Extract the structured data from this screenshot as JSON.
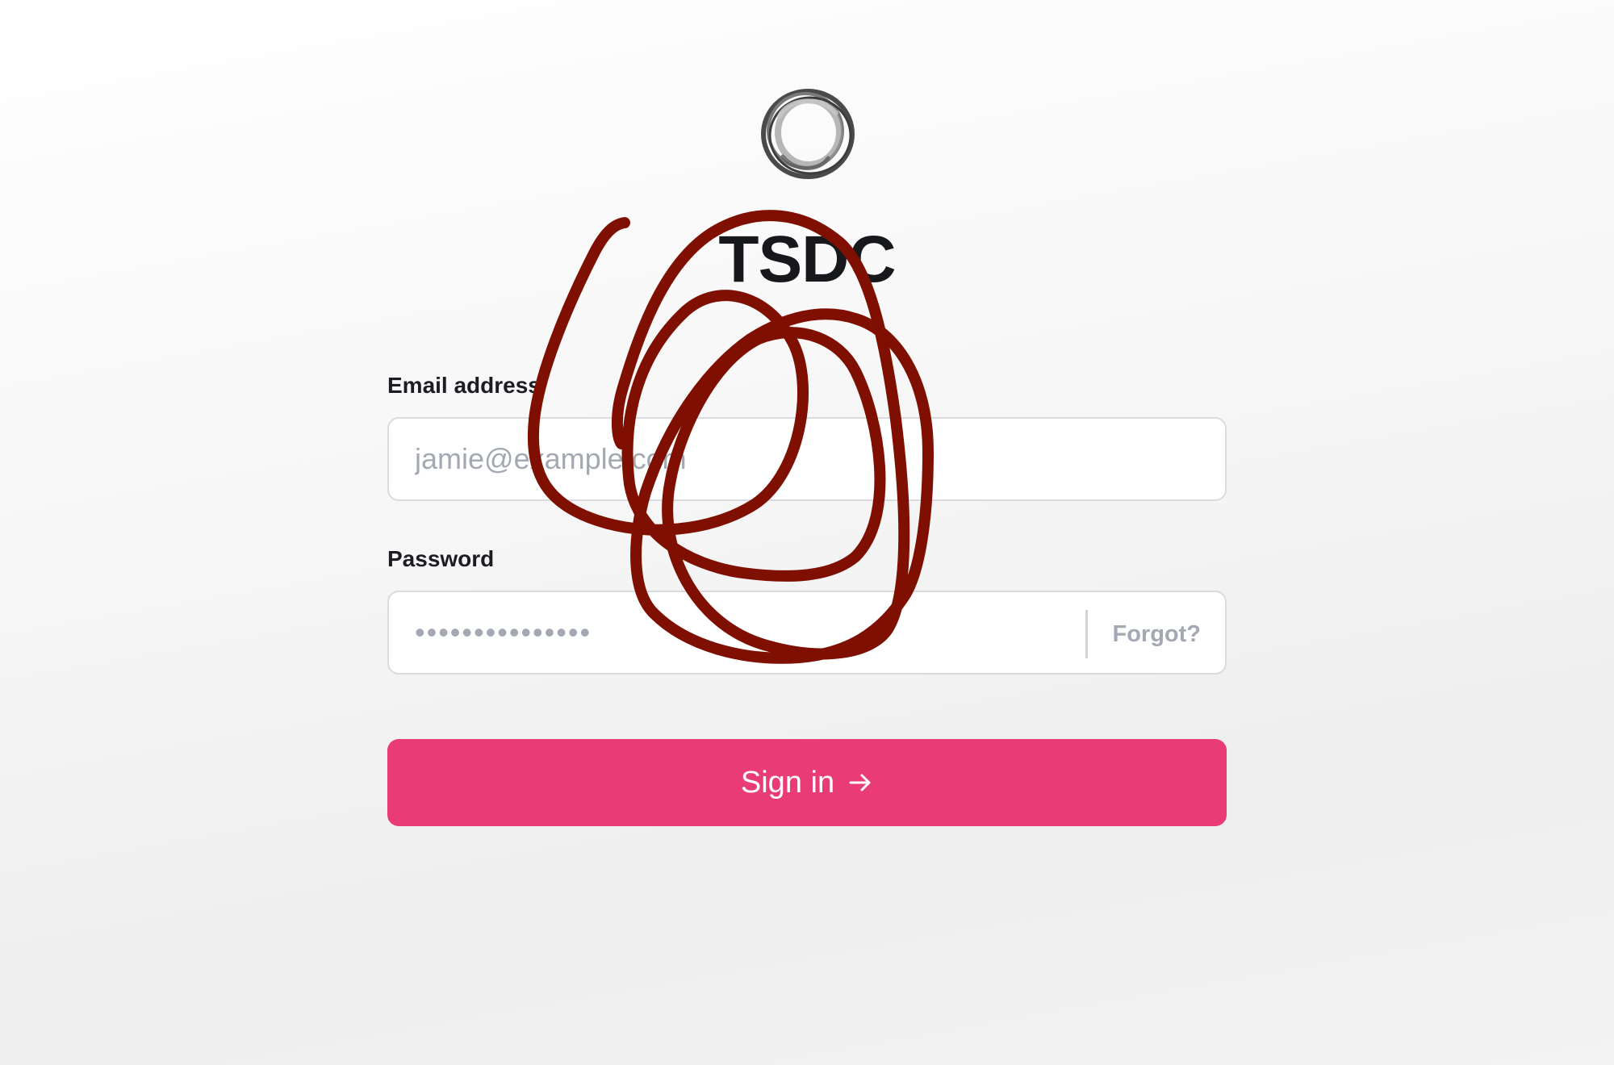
{
  "brand": {
    "name": "TSDC",
    "logo_icon": "ring-logo-icon"
  },
  "form": {
    "email": {
      "label": "Email address",
      "placeholder": "jamie@example.com",
      "value": ""
    },
    "password": {
      "label": "Password",
      "placeholder": "•••••••••••••••",
      "value": "",
      "forgot_label": "Forgot?"
    },
    "submit": {
      "label": "Sign in",
      "icon": "arrow-right-icon",
      "color": "#e93b76"
    }
  },
  "annotation": {
    "icon": "scribble-annotation",
    "color": "#7f0f00"
  },
  "colors": {
    "accent": "#e93b76",
    "input_border": "#d9dbe0",
    "placeholder": "#a3a8b2",
    "text": "#1b1d22"
  }
}
